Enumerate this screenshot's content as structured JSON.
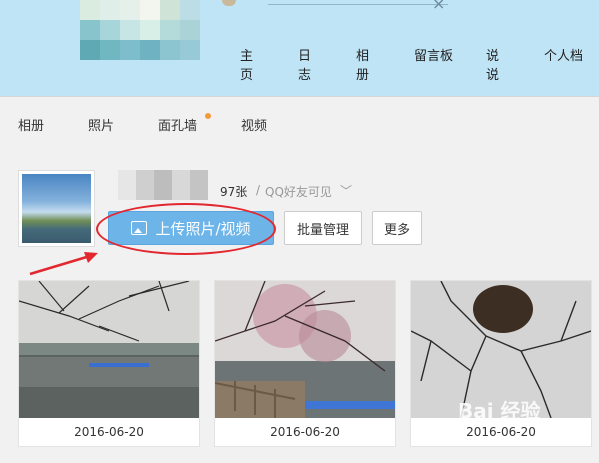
{
  "header": {
    "nav": [
      "主页",
      "日志",
      "相册",
      "留言板",
      "说说",
      "个人档"
    ],
    "avatar_mosaic": [
      "#d9ecdf",
      "#dfeee8",
      "#e6f0ea",
      "#f2f6ee",
      "#cfe3d7",
      "#bcdde6",
      "#88c4cc",
      "#a6d5da",
      "#c6e5e4",
      "#d8efe8",
      "#b4dad9",
      "#a9d3d6",
      "#5fa9b5",
      "#70b7c1",
      "#7dbdcc",
      "#6fb2c2",
      "#8cc4d0",
      "#98c9d6"
    ]
  },
  "tabs": [
    "相册",
    "照片",
    "面孔墙",
    "视频"
  ],
  "album": {
    "count": "97张",
    "separator": "/",
    "visibility": "QQ好友可见",
    "name_mosaic": [
      "#e6e6e6",
      "#cfcfcf",
      "#bdbdbd",
      "#d8d8d8",
      "#c4c4c4"
    ]
  },
  "buttons": {
    "upload": "上传照片/视频",
    "batch": "批量管理",
    "more": "更多"
  },
  "photos": [
    {
      "date": "2016-06-20"
    },
    {
      "date": "2016-06-20"
    },
    {
      "date": "2016-06-20"
    }
  ],
  "watermark": "Bai 经验"
}
